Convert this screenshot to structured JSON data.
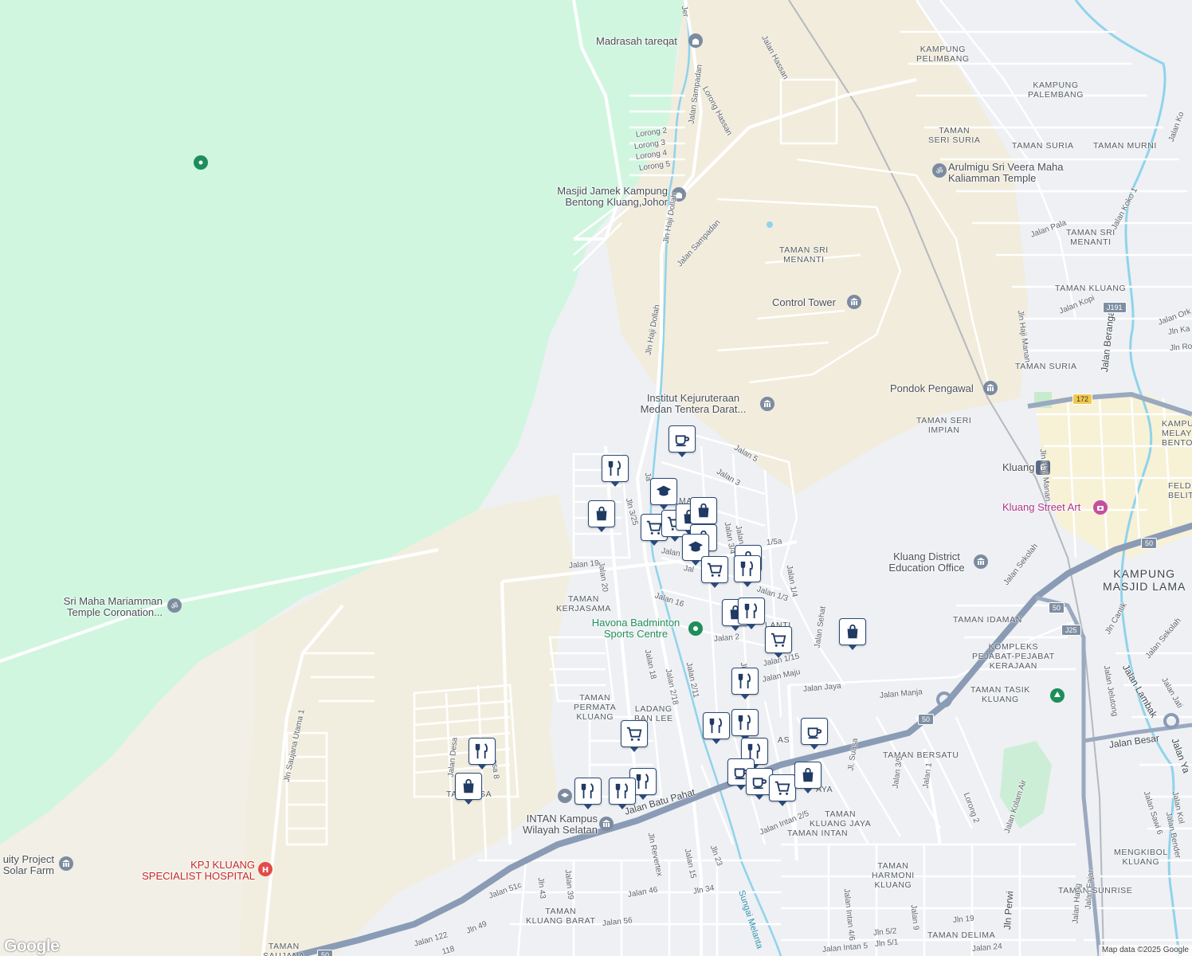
{
  "colors": {
    "forest": "#d1f6e0",
    "land": "#eef0f3",
    "sand": "#f1ecdc",
    "town": "#f7f1d6",
    "water": "#8fd3ec",
    "highway": "#8a9bb5",
    "road": "#ffffff",
    "pin_border": "#2b4a78"
  },
  "poi_labels": [
    {
      "id": "madrasah",
      "text": "Madrasah tareqat",
      "icon": "mosque-icon"
    },
    {
      "id": "masjid",
      "text": "Masjid Jamek Kampung\nBentong Kluang,Johor",
      "icon": "mosque-icon"
    },
    {
      "id": "control-tower",
      "text": "Control Tower",
      "icon": "landmark-icon"
    },
    {
      "id": "institut",
      "text": "Institut Kejuruteraan\nMedan Tentera Darat...",
      "icon": "landmark-icon"
    },
    {
      "id": "pondok",
      "text": "Pondok Pengawal",
      "icon": "landmark-icon"
    },
    {
      "id": "arulmigu",
      "text": "Arulmigu Sri Veera Maha\nKaliamman Temple",
      "icon": "temple-icon"
    },
    {
      "id": "kluang",
      "text": "Kluang",
      "icon": "train-icon"
    },
    {
      "id": "street-art",
      "text": "Kluang Street Art",
      "icon": "camera-icon"
    },
    {
      "id": "education-office",
      "text": "Kluang District\nEducation Office",
      "icon": "landmark-icon"
    },
    {
      "id": "havona",
      "text": "Havona Badminton\nSports Centre",
      "icon": "sports-icon"
    },
    {
      "id": "mariamman",
      "text": "Sri Maha Mariamman\nTemple Coronation...",
      "icon": "temple-icon"
    },
    {
      "id": "intan",
      "text": "INTAN Kampus\nWilayah Selatan",
      "icon": "landmark-icon"
    },
    {
      "id": "kpj",
      "text": "KPJ KLUANG\nSPECIALIST HOSPITAL",
      "icon": "hospital-icon"
    },
    {
      "id": "solar",
      "text": "uity Project\nSolar Farm",
      "icon": "landmark-icon"
    }
  ],
  "area_labels": [
    {
      "id": "kampung-pelimbang",
      "text": "KAMPUNG\nPELIMBANG"
    },
    {
      "id": "kampung-palembang",
      "text": "KAMPUNG\nPALEMBANG"
    },
    {
      "id": "taman-seri-suria",
      "text": "TAMAN\nSERI SURIA"
    },
    {
      "id": "taman-suria-1",
      "text": "TAMAN SURIA"
    },
    {
      "id": "taman-murni",
      "text": "TAMAN MURNI"
    },
    {
      "id": "taman-sri-menanti-1",
      "text": "TAMAN SRI\nMENANTI"
    },
    {
      "id": "taman-sri-menanti-2",
      "text": "TAMAN SRI\nMENANTI"
    },
    {
      "id": "taman-kluang",
      "text": "TAMAN KLUANG"
    },
    {
      "id": "taman-suria-2",
      "text": "TAMAN SURIA"
    },
    {
      "id": "taman-seri-impian",
      "text": "TAMAN SERI\nIMPIAN"
    },
    {
      "id": "kampung-melay",
      "text": "KAMPUN\nMELAY\nBENTONG"
    },
    {
      "id": "feld",
      "text": "FELD\nBELIT"
    },
    {
      "id": "kampung-masjid-lama",
      "text": "KAMPUNG\nMASJID LAMA"
    },
    {
      "id": "taman-idaman",
      "text": "TAMAN IDAMAN"
    },
    {
      "id": "kompleks",
      "text": "KOMPLEKS\nPEJABAT-PEJABAT\nKERAJAAN"
    },
    {
      "id": "taman-tasik",
      "text": "TAMAN TASIK\nKLUANG"
    },
    {
      "id": "taman-kerjasama",
      "text": "TAMAN\nKERJASAMA"
    },
    {
      "id": "taman-permata",
      "text": "TAMAN\nPERMATA\nKLUANG"
    },
    {
      "id": "ladang",
      "text": "LADANG\nBAN LEE"
    },
    {
      "id": "taman-bersatu",
      "text": "TAMAN BERSATU"
    },
    {
      "id": "taman-kluang-jaya",
      "text": "TAMAN\nKLUANG JAYA"
    },
    {
      "id": "taman-intan",
      "text": "TAMAN INTAN"
    },
    {
      "id": "taman-harmoni",
      "text": "TAMAN\nHARMONI\nKLUANG"
    },
    {
      "id": "mengkibol",
      "text": "MENGKIBOL\nKLUANG"
    },
    {
      "id": "taman-sunrise",
      "text": "TAMAN SUNRISE"
    },
    {
      "id": "taman-delima",
      "text": "TAMAN DELIMA"
    },
    {
      "id": "taman-kluang-barat",
      "text": "TAMAN\nKLUANG BARAT"
    },
    {
      "id": "taman-saujana",
      "text": "TAMAN\nSAUJANA"
    },
    {
      "id": "taman-desa",
      "text": "TA      ESA"
    },
    {
      "id": "ma",
      "text": "MA"
    },
    {
      "id": "lanti",
      "text": "LANTI"
    },
    {
      "id": "as",
      "text": "AS"
    },
    {
      "id": "aya",
      "text": "AYA"
    }
  ],
  "road_labels": [
    {
      "id": "jalan-hassan",
      "text": "Jalan Hassan"
    },
    {
      "id": "lorong-hassan",
      "text": "Lorong Hassan"
    },
    {
      "id": "jalan-sampadan-1",
      "text": "Jalan Sampadan"
    },
    {
      "id": "lorong-2",
      "text": "Lorong 2"
    },
    {
      "id": "lorong-3",
      "text": "Lorong 3"
    },
    {
      "id": "lorong-4",
      "text": "Lorong 4"
    },
    {
      "id": "lorong-5",
      "text": "Lorong 5"
    },
    {
      "id": "jln-haji-dollah-1",
      "text": "Jln Haji Dollah"
    },
    {
      "id": "jalan-sampadan-2",
      "text": "Jalan Sampadan"
    },
    {
      "id": "jln-haji-dollah-2",
      "text": "Jln Haji Dollah"
    },
    {
      "id": "jalan-5",
      "text": "Jalan 5"
    },
    {
      "id": "jalan-3",
      "text": "Jalan 3"
    },
    {
      "id": "jln-3-25",
      "text": "Jln 3/25"
    },
    {
      "id": "jalan-19",
      "text": "Jalan 19"
    },
    {
      "id": "jalan-20",
      "text": "Jalan 20"
    },
    {
      "id": "jalan-16",
      "text": "Jalan 16"
    },
    {
      "id": "jalan-1-5a",
      "text": "1/5a"
    },
    {
      "id": "jalan-1-3",
      "text": "Jalan 1/3"
    },
    {
      "id": "jalan-1-4",
      "text": "Jalan 1/4"
    },
    {
      "id": "jalan-2",
      "text": "Jalan 2"
    },
    {
      "id": "jalan-1-15",
      "text": "Jalan 1/15"
    },
    {
      "id": "jalan-maju",
      "text": "Jalan Maju"
    },
    {
      "id": "jalan-sehat",
      "text": "Jalan Sehat"
    },
    {
      "id": "jalan-jaya",
      "text": "Jalan Jaya"
    },
    {
      "id": "jalan-manja",
      "text": "Jalan Manja"
    },
    {
      "id": "jalan-18",
      "text": "Jalan 18"
    },
    {
      "id": "jalan-2-18",
      "text": "Jalan 2/18"
    },
    {
      "id": "jalan-2-11",
      "text": "Jalan 2/11"
    },
    {
      "id": "jalan-batu-pahat",
      "text": "Jalan Batu Pahat"
    },
    {
      "id": "jln-revertex",
      "text": "Jln Revertex"
    },
    {
      "id": "jalan-15",
      "text": "Jalan 15"
    },
    {
      "id": "jln-23",
      "text": "Jln 23"
    },
    {
      "id": "jalan-intan-2-5",
      "text": "Jalan Intan 2/5"
    },
    {
      "id": "jl-suasa",
      "text": "Jl. Suasa"
    },
    {
      "id": "jalan-3-5",
      "text": "Jalan 3/5"
    },
    {
      "id": "jalan-1",
      "text": "Jalan 1"
    },
    {
      "id": "lorong-2b",
      "text": "Lorong 2"
    },
    {
      "id": "jalan-kolam-air",
      "text": "Jalan Kolam Air"
    },
    {
      "id": "jalan-sawi-6",
      "text": "Jalan Sawi 6"
    },
    {
      "id": "jalan-bender",
      "text": "Jalan Bender"
    },
    {
      "id": "jalan-kolam",
      "text": "Jalan Kol"
    },
    {
      "id": "jalan-besar",
      "text": "Jalan Besar"
    },
    {
      "id": "jalan-lambak",
      "text": "Jalan Lambak"
    },
    {
      "id": "jalan-jelutong",
      "text": "Jalan Jelutong"
    },
    {
      "id": "jln-cantik",
      "text": "Jln Cantik"
    },
    {
      "id": "jalan-sekolah-1",
      "text": "Jalan Sekolah"
    },
    {
      "id": "jalan-sekolah-2",
      "text": "Jalan Sekolah"
    },
    {
      "id": "jalan-jati",
      "text": "Jalan Jati"
    },
    {
      "id": "jalan-ya",
      "text": "Jalan Ya"
    },
    {
      "id": "jalan-pala",
      "text": "Jalan Pala"
    },
    {
      "id": "jalan-koko-1",
      "text": "Jalan Koko 1"
    },
    {
      "id": "jalan-ko",
      "text": "Jalan Ko"
    },
    {
      "id": "jln-haji-manan-1",
      "text": "Jln Haji Manan"
    },
    {
      "id": "jln-haji-manan-2",
      "text": "Jln Haji Manan"
    },
    {
      "id": "jalan-kopi",
      "text": "Jalan Kopi"
    },
    {
      "id": "jalan-berangan",
      "text": "Jalan Berangan"
    },
    {
      "id": "jalan-ork",
      "text": "Jalan Ork"
    },
    {
      "id": "jln-ka",
      "text": "Jln Ka"
    },
    {
      "id": "jln-ro",
      "text": "Jln Ro"
    },
    {
      "id": "jln-saujana",
      "text": "Jln Saujana Utama 1"
    },
    {
      "id": "jalan-desa",
      "text": "Jalan Desa"
    },
    {
      "id": "jalan-desa-8",
      "text": "esa 8"
    },
    {
      "id": "jln-43",
      "text": "Jln 43"
    },
    {
      "id": "jalan-39",
      "text": "Jalan 39"
    },
    {
      "id": "jalan-51c",
      "text": "Jalan 51c"
    },
    {
      "id": "jalan-46",
      "text": "Jalan 46"
    },
    {
      "id": "jln-34",
      "text": "Jln 34"
    },
    {
      "id": "jalan-56",
      "text": "Jalan 56"
    },
    {
      "id": "jln-49",
      "text": "Jln 49"
    },
    {
      "id": "jalan-122",
      "text": "Jalan 122"
    },
    {
      "id": "jalan-118",
      "text": "118"
    },
    {
      "id": "jalan-intan-4-6",
      "text": "Jalan Intan 4/6"
    },
    {
      "id": "jalan-9",
      "text": "Jalan 9"
    },
    {
      "id": "jln-19",
      "text": "Jln 19"
    },
    {
      "id": "jln-5-2",
      "text": "Jln 5/2"
    },
    {
      "id": "jln-5-1",
      "text": "Jln 5/1"
    },
    {
      "id": "jalan-intan-5",
      "text": "Jalan Intan 5"
    },
    {
      "id": "jalan-24",
      "text": "Jalan 24"
    },
    {
      "id": "jln-perwira",
      "text": "Jln Perwi"
    },
    {
      "id": "jalan-fajar",
      "text": "Jalan Fajar"
    },
    {
      "id": "jalan-hang",
      "text": "Jalan Hang"
    },
    {
      "id": "sungai-melantai",
      "text": "Sungai Melanta"
    },
    {
      "id": "jln-small",
      "text": "Jln"
    },
    {
      "id": "jalan-ja",
      "text": "Ja"
    },
    {
      "id": "jalan-2s",
      "text": "Jalan 2"
    },
    {
      "id": "jalan-3a",
      "text": "Jalan 3/4"
    },
    {
      "id": "jalan-lan",
      "text": "Jalan"
    },
    {
      "id": "jalan-2v",
      "text": "Jal"
    },
    {
      "id": "jln-ber",
      "text": "Jer"
    }
  ],
  "route_shields": [
    {
      "id": "j191",
      "text": "J191"
    },
    {
      "id": "r172",
      "text": "172"
    },
    {
      "id": "r50a",
      "text": "50"
    },
    {
      "id": "r50b",
      "text": "50"
    },
    {
      "id": "r50c",
      "text": "50"
    },
    {
      "id": "j25",
      "text": "J25"
    },
    {
      "id": "r50d",
      "text": "50"
    }
  ],
  "pins": [
    {
      "id": "cafe-1",
      "icon": "coffee-icon"
    },
    {
      "id": "restaurant-1",
      "icon": "fork-knife-icon"
    },
    {
      "id": "shopping-1",
      "icon": "shopping-bag-icon"
    },
    {
      "id": "school-1",
      "icon": "graduation-cap-icon"
    },
    {
      "id": "grocery-1",
      "icon": "shopping-cart-icon"
    },
    {
      "id": "grocery-2",
      "icon": "shopping-cart-icon"
    },
    {
      "id": "shopping-2",
      "icon": "shopping-bag-icon"
    },
    {
      "id": "shopping-3",
      "icon": "shopping-bag-icon"
    },
    {
      "id": "school-2",
      "icon": "graduation-cap-icon"
    },
    {
      "id": "shopping-4",
      "icon": "shopping-bag-icon"
    },
    {
      "id": "grocery-3",
      "icon": "shopping-cart-icon"
    },
    {
      "id": "restaurant-2",
      "icon": "fork-knife-icon"
    },
    {
      "id": "shopping-5",
      "icon": "shopping-bag-icon"
    },
    {
      "id": "restaurant-3",
      "icon": "fork-knife-icon"
    },
    {
      "id": "grocery-4",
      "icon": "shopping-cart-icon"
    },
    {
      "id": "shopping-6",
      "icon": "shopping-bag-icon"
    },
    {
      "id": "restaurant-4",
      "icon": "fork-knife-icon"
    },
    {
      "id": "restaurant-5",
      "icon": "fork-knife-icon"
    },
    {
      "id": "restaurant-6",
      "icon": "fork-knife-icon"
    },
    {
      "id": "cafe-2",
      "icon": "coffee-icon"
    },
    {
      "id": "grocery-5",
      "icon": "shopping-cart-icon"
    },
    {
      "id": "restaurant-7",
      "icon": "fork-knife-icon"
    },
    {
      "id": "restaurant-8",
      "icon": "fork-knife-icon"
    },
    {
      "id": "restaurant-9",
      "icon": "fork-knife-icon"
    },
    {
      "id": "restaurant-10",
      "icon": "fork-knife-icon"
    },
    {
      "id": "cafe-3",
      "icon": "coffee-icon"
    },
    {
      "id": "cafe-4",
      "icon": "coffee-icon"
    },
    {
      "id": "grocery-6",
      "icon": "shopping-cart-icon"
    },
    {
      "id": "shopping-7",
      "icon": "shopping-bag-icon"
    },
    {
      "id": "restaurant-11",
      "icon": "fork-knife-icon"
    },
    {
      "id": "shopping-8",
      "icon": "shopping-bag-icon"
    }
  ],
  "attribution": {
    "logo": "Google",
    "map_data": "Map data ©2025 Google"
  }
}
